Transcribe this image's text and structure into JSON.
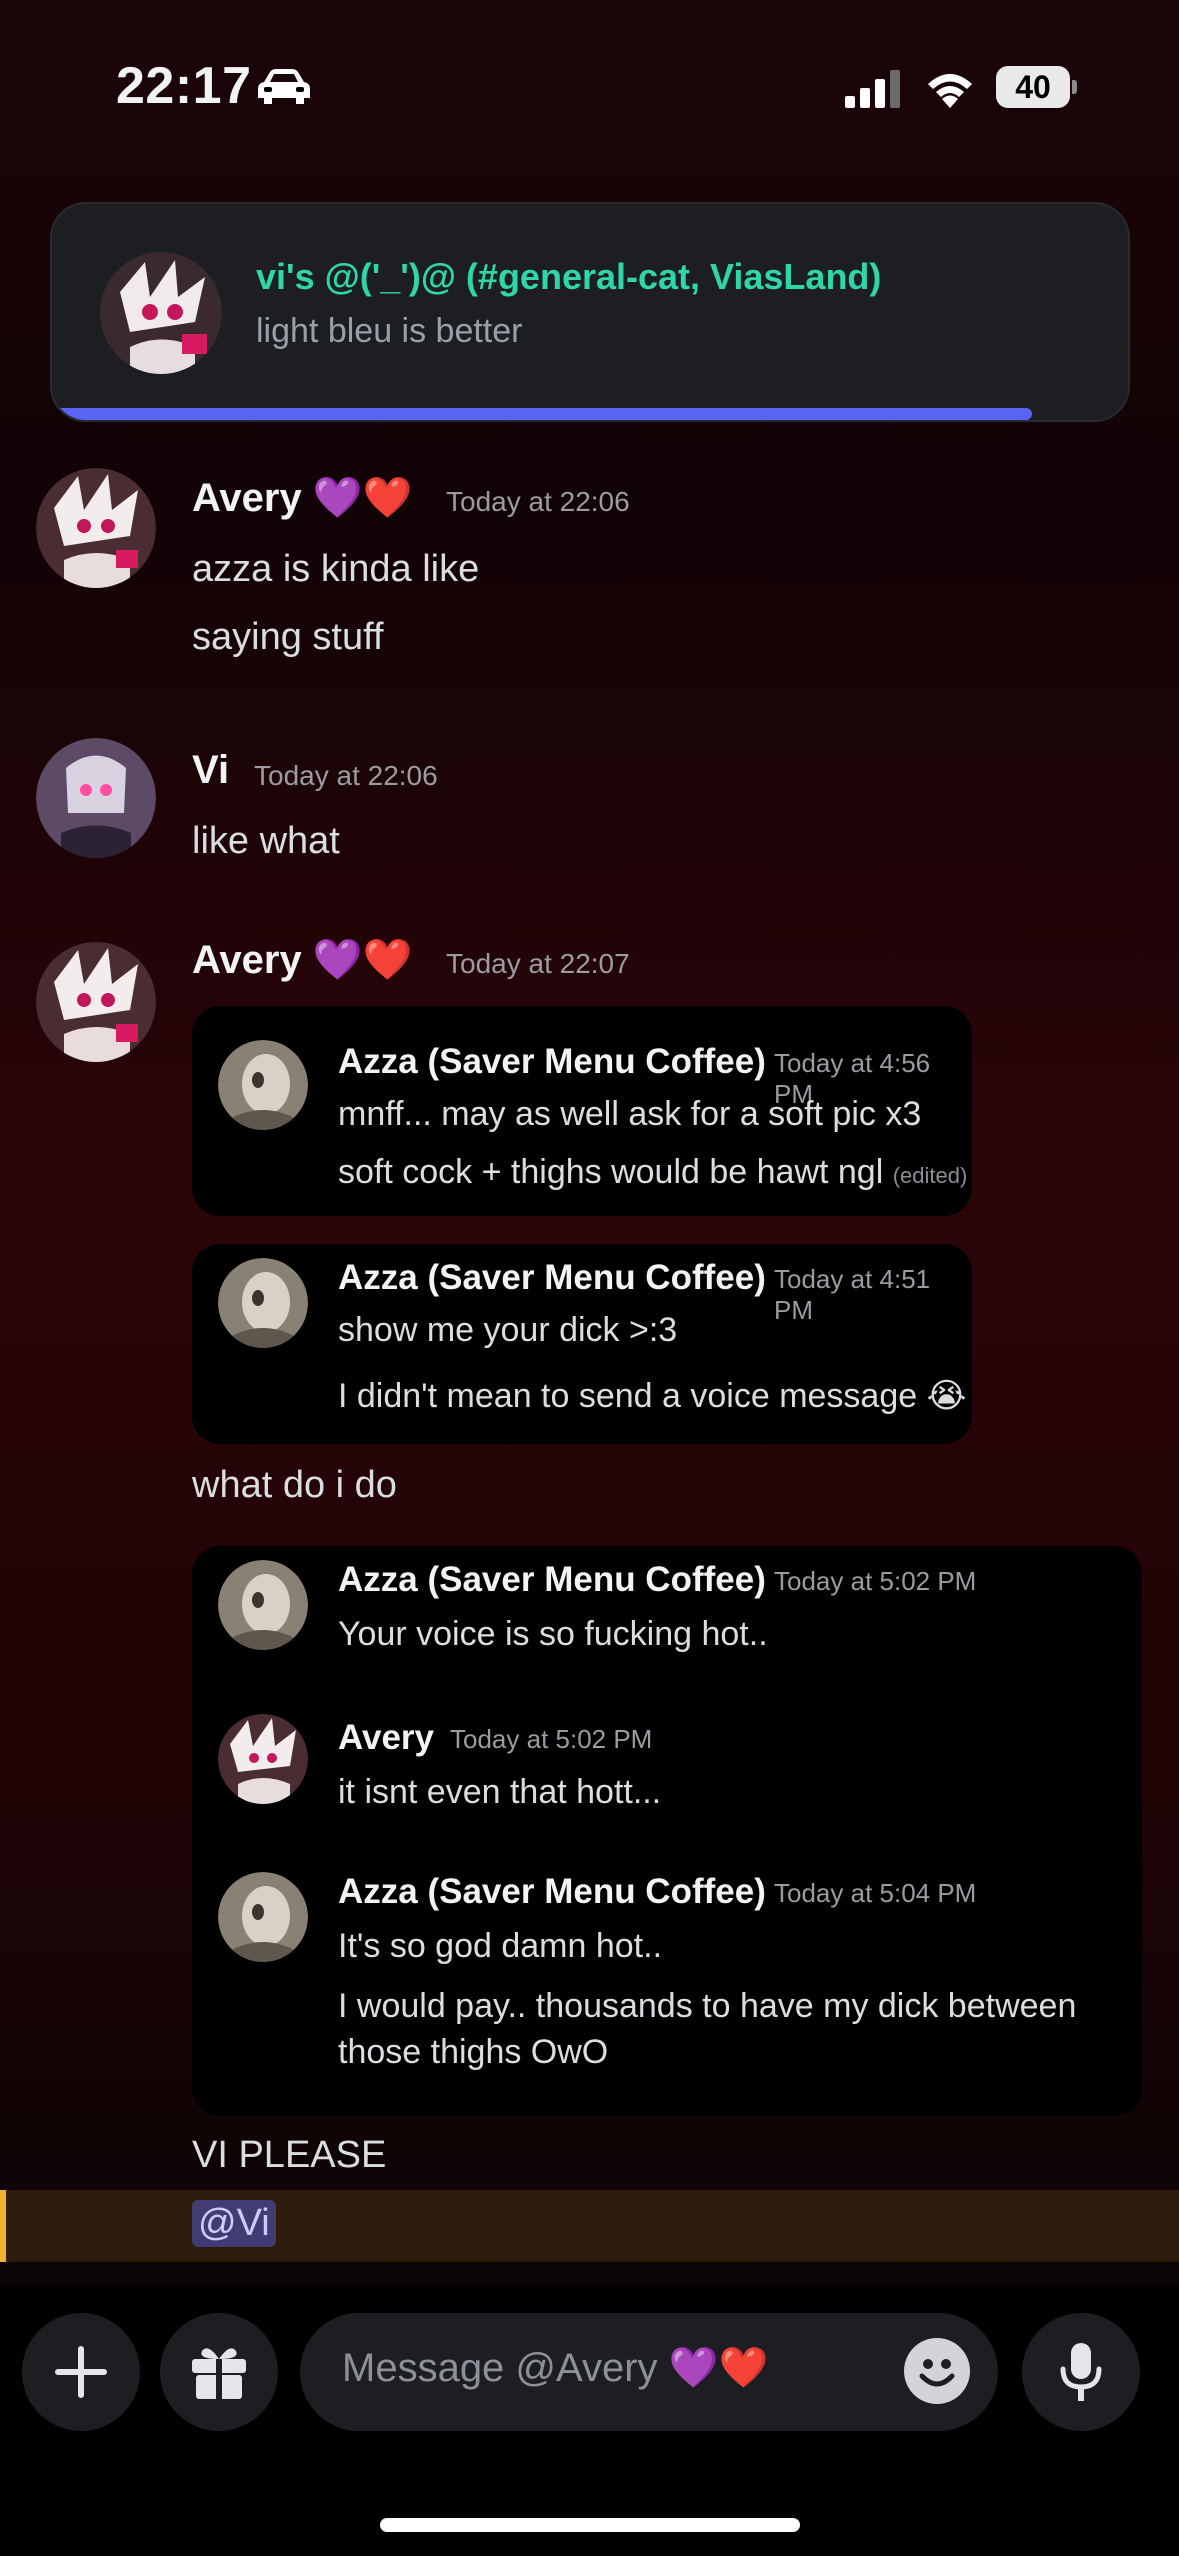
{
  "status_bar": {
    "time": "22:17",
    "battery": "40"
  },
  "notification": {
    "title": "vi's @('_')@ (#general-cat, ViasLand)",
    "body": "light bleu is better"
  },
  "messages": [
    {
      "author": "Avery 💜❤️",
      "timestamp": "Today at 22:06",
      "lines": [
        "azza is kinda like",
        "saying stuff"
      ]
    },
    {
      "author": "Vi",
      "timestamp": "Today at 22:06",
      "lines": [
        "like what"
      ]
    },
    {
      "author": "Avery 💜❤️",
      "timestamp": "Today at 22:07"
    }
  ],
  "embeds": [
    {
      "author": "Azza (Saver Menu Coffee)",
      "timestamp": "Today at 4:56 PM",
      "line1": "mnff... may as well ask for a soft pic x3",
      "line2": "soft cock + thighs would be hawt ngl",
      "edited": "(edited)"
    },
    {
      "author": "Azza (Saver Menu Coffee)",
      "timestamp": "Today at 4:51 PM",
      "line1": "show me your dick >:3",
      "line2": "I didn't mean to send a voice message 😭"
    }
  ],
  "between_text": "what do i do",
  "embed3": [
    {
      "author": "Azza (Saver Menu Coffee)",
      "timestamp": "Today at 5:02 PM",
      "line1": "Your voice is so fucking hot.."
    },
    {
      "author": "Avery",
      "timestamp": "Today at 5:02 PM",
      "line1": "it isnt even that hott..."
    },
    {
      "author": "Azza (Saver Menu Coffee)",
      "timestamp": "Today at 5:04 PM",
      "line1": "It's so god damn hot..",
      "line2": "I would pay.. thousands to have my dick between",
      "line3": "those thighs OwO"
    }
  ],
  "after_text": "VI PLEASE",
  "mention": "@Vi",
  "composer": {
    "placeholder": "Message @Avery 💜❤️"
  },
  "colors": {
    "accent": "#5865f2",
    "notif_title": "#2fd6a6",
    "mention_bar": "#f0b232"
  }
}
